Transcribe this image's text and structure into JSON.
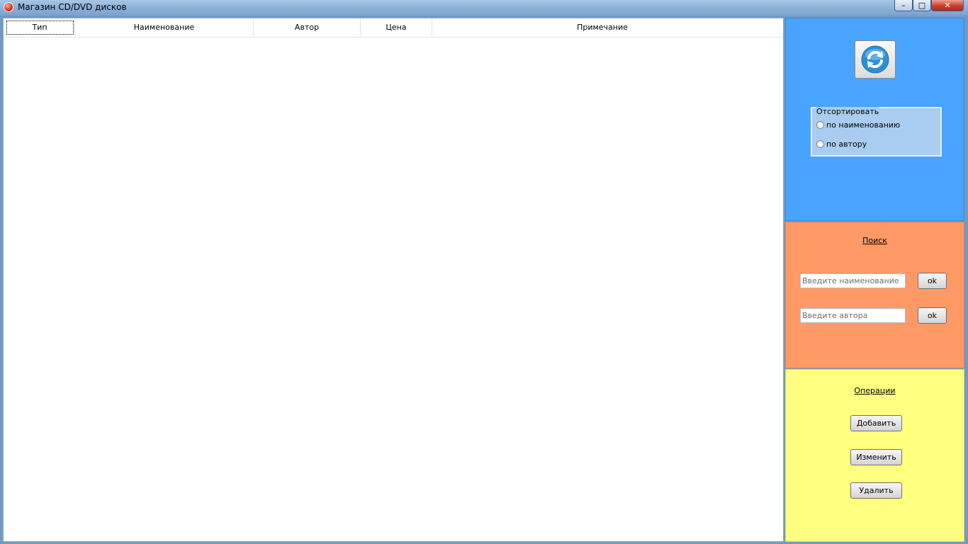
{
  "window": {
    "title": "Магазин CD/DVD дисков",
    "minimize_label": "–",
    "maximize_label": "□",
    "close_label": "✕"
  },
  "grid": {
    "columns": [
      "Тип",
      "Наименование",
      "Автор",
      "Цена",
      "Примечание"
    ],
    "rows": []
  },
  "sort": {
    "legend": "Отсортировать",
    "options": [
      "по наименованию",
      "по автору"
    ]
  },
  "search": {
    "title": "Поиск",
    "name_placeholder": "Введите наименование",
    "author_placeholder": "Введите автора",
    "ok_label": "ok"
  },
  "operations": {
    "title": "Операции",
    "add_label": "Добавить",
    "edit_label": "Изменить",
    "delete_label": "Удалить"
  },
  "colors": {
    "sort_panel": "#48a4ff",
    "search_panel": "#ff9966",
    "operations_panel": "#ffff80"
  },
  "icons": {
    "app": "app-disc-icon",
    "refresh": "refresh-icon"
  }
}
